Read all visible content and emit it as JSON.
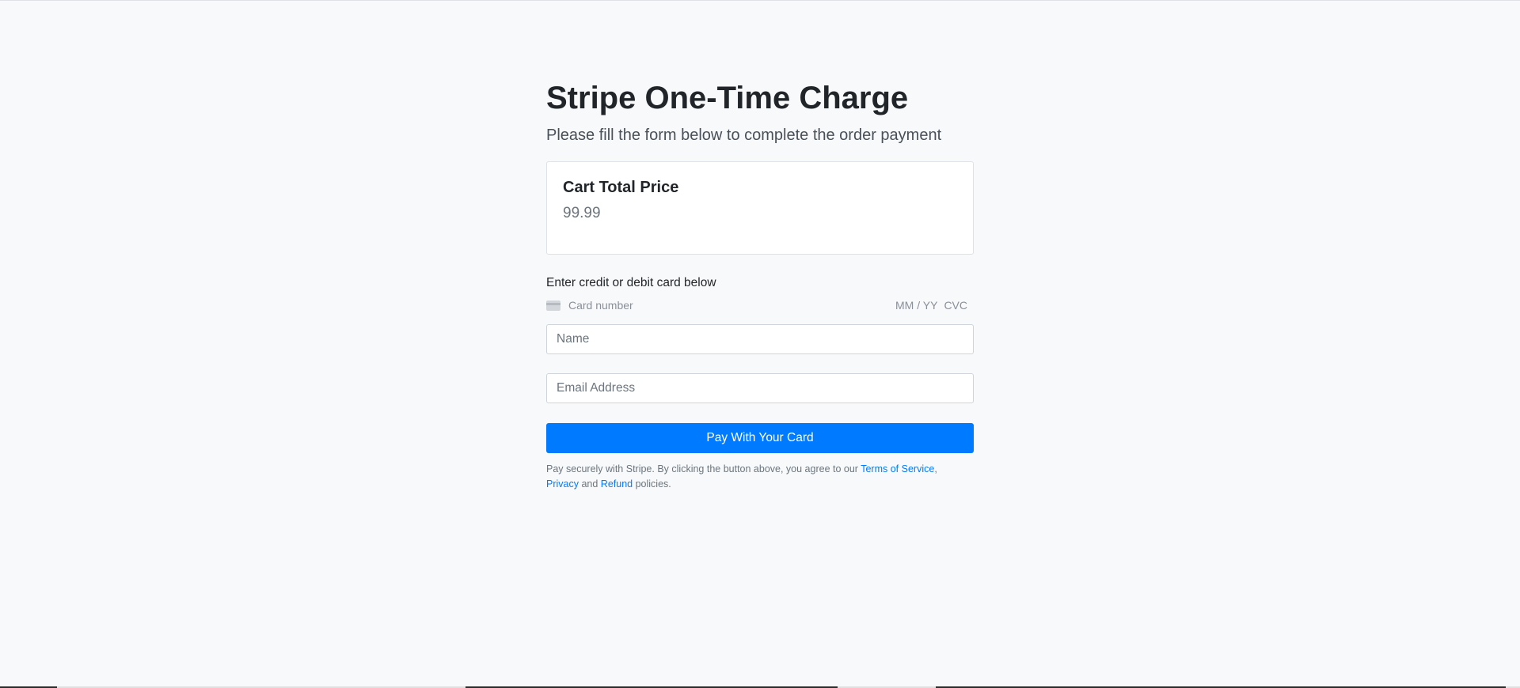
{
  "header": {
    "title": "Stripe One-Time Charge",
    "subtitle": "Please fill the form below to complete the order payment"
  },
  "cart": {
    "title": "Cart Total Price",
    "total": "99.99"
  },
  "payment": {
    "card_label": "Enter credit or debit card below",
    "card_number_placeholder": "Card number",
    "card_expiry_placeholder": "MM / YY",
    "card_cvc_placeholder": "CVC",
    "name_placeholder": "Name",
    "email_placeholder": "Email Address",
    "pay_button_label": "Pay With Your Card"
  },
  "terms": {
    "text_before": "Pay securely with Stripe. By clicking the button above, you agree to our ",
    "terms_link": "Terms of Service",
    "sep1": ",",
    "privacy_link": "Privacy",
    "and": " and ",
    "refund_link": "Refund",
    "text_after": " policies."
  },
  "colors": {
    "background": "#f8f9fa",
    "primary": "#007bff",
    "text": "#212529",
    "muted": "#6c757d"
  },
  "icons": {
    "card_icon": "credit-card-icon"
  }
}
